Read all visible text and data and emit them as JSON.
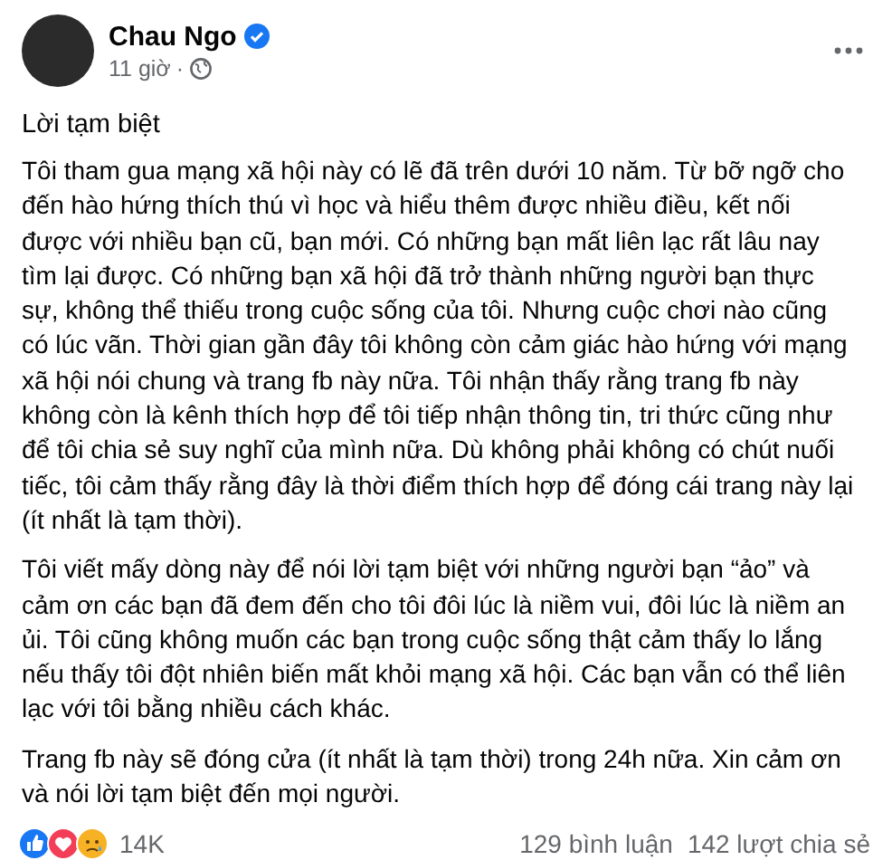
{
  "post": {
    "author": "Chau Ngo",
    "verified": true,
    "time": "11 giờ",
    "separator": "·",
    "title": "Lời tạm biệt",
    "paragraphs": [
      "Tôi tham gua mạng xã hội này có lẽ đã trên dưới 10 năm. Từ bỡ ngỡ cho đến hào hứng thích thú vì học và hiểu thêm được nhiều điều, kết nối được với nhiều bạn cũ, bạn mới. Có những bạn mất liên lạc rất lâu nay tìm lại được. Có những bạn xã hội đã trở thành những người bạn thực sự, không thể thiếu trong cuộc sống của tôi. Nhưng cuộc chơi nào cũng có lúc vãn. Thời gian gần đây tôi không còn cảm giác hào hứng với mạng xã hội nói chung và trang fb này nữa. Tôi nhận thấy rằng trang fb này không còn là kênh thích hợp để tôi tiếp nhận thông tin, tri thức cũng như để tôi chia sẻ suy nghĩ của mình nữa. Dù không phải không có chút nuối tiếc, tôi cảm thấy rằng đây là thời điểm thích hợp để đóng cái trang này lại (ít nhất là tạm thời).",
      "Tôi viết mấy dòng này để nói lời tạm biệt với những người bạn “ảo” và cảm ơn các bạn đã đem đến cho tôi đôi lúc là niềm vui, đôi lúc là niềm an ủi. Tôi cũng không muốn các bạn trong cuộc sống thật cảm thấy lo lắng nếu thấy tôi đột nhiên biến mất khỏi mạng xã hội. Các bạn vẫn có thể liên lạc với tôi bằng nhiều cách khác.",
      "Trang fb này sẽ đóng cửa (ít nhất là tạm thời) trong 24h nữa. Xin cảm ơn và nói lời tạm biệt đến mọi người."
    ]
  },
  "footer": {
    "reactions": [
      {
        "kind": "like"
      },
      {
        "kind": "love"
      },
      {
        "kind": "sad"
      }
    ],
    "reaction_count": "14K",
    "comments": "129 bình luận",
    "shares": "142 lượt chia sẻ"
  }
}
